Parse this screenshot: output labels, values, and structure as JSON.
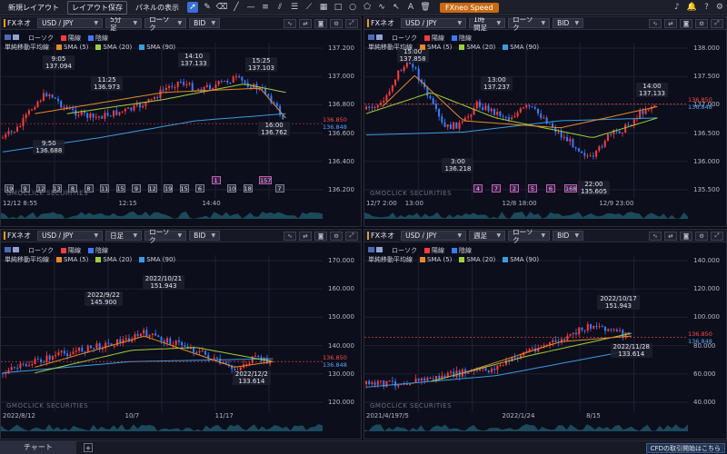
{
  "toolbar": {
    "new_layout": "新規レイアウト",
    "save_layout": "レイアウト保存",
    "show_panel": "パネルの表示",
    "speed": "FXneo Speed"
  },
  "status": {
    "tab": "チャート",
    "plus": "+",
    "cfd_link": "CFDの取引開始はこちら"
  },
  "legend": {
    "candle": "ローソク",
    "up": "陽線",
    "down": "陰線",
    "ma_label": "単純移動平均線",
    "sma5": "SMA (5)",
    "sma20": "SMA (20)",
    "sma90": "SMA (90)",
    "colors": {
      "sma5": "#e8892a",
      "sma20": "#9fcf3a",
      "sma90": "#3a9be0"
    }
  },
  "watermark": "GMOCLICK SECURITIES",
  "panels": [
    {
      "brand": "FXネオ",
      "symbol": "USD / JPY",
      "period": "5分足",
      "chart_type": "ローソク",
      "side": "BID",
      "y_ticks": [
        "137.200",
        "137.000",
        "136.800",
        "136.600",
        "136.400",
        "136.200"
      ],
      "dates": [
        "12/12 8:55",
        "12:15",
        "14:40"
      ],
      "annotations": [
        {
          "t": "9:05",
          "v": "137.094"
        },
        {
          "t": "11:25",
          "v": "136.973"
        },
        {
          "t": "14:10",
          "v": "137.133"
        },
        {
          "t": "15:25",
          "v": "137.103"
        },
        {
          "t": "9:50",
          "v": "136.688"
        },
        {
          "t": "16:00",
          "v": "136.762"
        }
      ],
      "price_red": "136.850",
      "price_blue": "136.848",
      "markers": [
        "19",
        "9",
        "12",
        "13",
        "8",
        "8",
        "11",
        "15",
        "9",
        "12",
        "19",
        "15",
        "6",
        "1",
        "10",
        "18",
        "157",
        "7"
      ]
    },
    {
      "brand": "FXネオ",
      "symbol": "USD / JPY",
      "period": "1時間足",
      "chart_type": "ローソク",
      "side": "BID",
      "y_ticks": [
        "138.000",
        "137.500",
        "137.000",
        "136.500",
        "136.000",
        "135.500"
      ],
      "dates": [
        "12/7 2:00",
        "13:00",
        "12/8 18:00",
        "12/9 23:00"
      ],
      "annotations": [
        {
          "t": "15:00",
          "v": "137.858"
        },
        {
          "t": "13:00",
          "v": "137.237"
        },
        {
          "t": "14:00",
          "v": "137.133"
        },
        {
          "t": "3:00",
          "v": "136.218"
        },
        {
          "t": "22:00",
          "v": "135.605"
        }
      ],
      "price_red": "136.850",
      "price_blue": "136.848",
      "markers": [
        "4",
        "7",
        "2",
        "5",
        "6",
        "168"
      ]
    },
    {
      "brand": "FXネオ",
      "symbol": "USD / JPY",
      "period": "日足",
      "chart_type": "ローソク",
      "side": "BID",
      "y_ticks": [
        "170.000",
        "160.000",
        "150.000",
        "140.000",
        "130.000",
        "120.000"
      ],
      "dates": [
        "2022/8/12",
        "10/7",
        "11/17"
      ],
      "annotations": [
        {
          "t": "2022/9/22",
          "v": "145.900"
        },
        {
          "t": "2022/10/21",
          "v": "151.943"
        },
        {
          "t": "2022/12/2",
          "v": "133.614"
        }
      ],
      "price_red": "136.850",
      "price_blue": "136.848"
    },
    {
      "brand": "FXネオ",
      "symbol": "USD / JPY",
      "period": "週足",
      "chart_type": "ローソク",
      "side": "BID",
      "y_ticks": [
        "140.000",
        "120.000",
        "100.000",
        "80.000",
        "60.000",
        "40.000"
      ],
      "dates": [
        "2021/4/19",
        "7/5",
        "2022/1/24",
        "8/15"
      ],
      "annotations": [
        {
          "t": "2022/10/17",
          "v": "151.943"
        },
        {
          "t": "2022/11/28",
          "v": "133.614"
        }
      ],
      "price_red": "136.850",
      "price_blue": "136.848"
    }
  ]
}
